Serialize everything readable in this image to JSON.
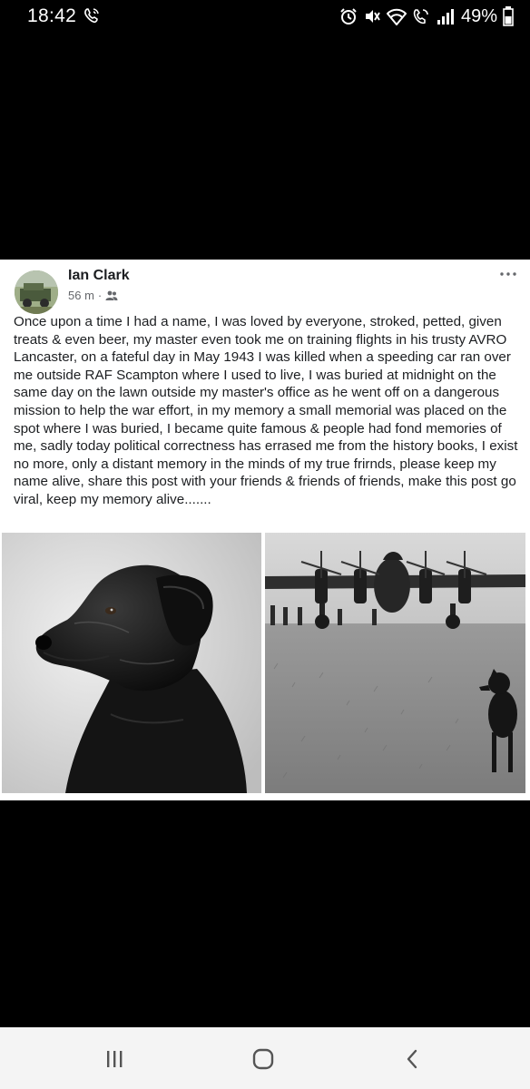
{
  "status_bar": {
    "time": "18:42",
    "battery": "49%"
  },
  "post": {
    "author": "Ian Clark",
    "time": "56 m",
    "separator": "·",
    "text": "Once upon a time I had a name, I was loved by everyone, stroked, petted, given treats & even beer, my master even took me on training flights in his trusty AVRO Lancaster, on a fateful day in May 1943 I was killed when a speeding car ran over me outside RAF Scampton where I used to live, I was buried at midnight on the same day on the lawn outside my master's office as he went off on a dangerous mission to help the war effort, in my memory a small memorial was placed on the spot where I was buried, I became quite famous & people had fond memories of me, sadly today political correctness has errased me from the history books, I exist no more, only a distant memory in the minds of my true frirnds, please keep my name alive, share this post with your friends & friends of friends, make this post go viral, keep my memory alive.......",
    "audience_icon": "friends-icon",
    "more_icon": "more-options-icon",
    "photos": [
      {
        "icon": "labrador-portrait-photo"
      },
      {
        "icon": "lancaster-bomber-with-dog-photo"
      }
    ]
  },
  "nav_bar": {
    "recents_icon": "recent-apps-icon",
    "home_icon": "home-icon",
    "back_icon": "back-icon"
  }
}
